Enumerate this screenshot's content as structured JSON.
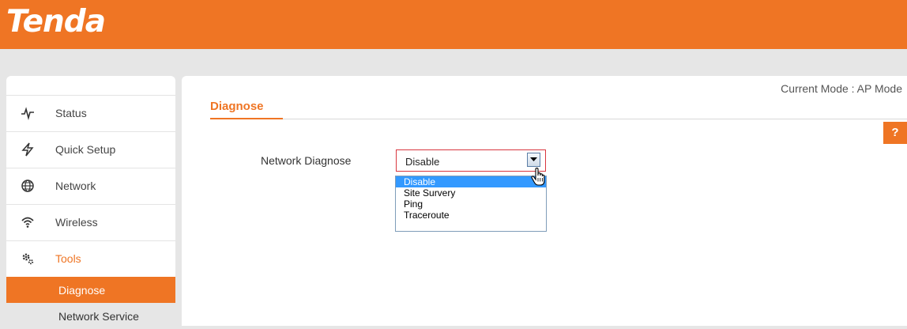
{
  "brand": {
    "logo_text": "Tenda",
    "accent": "#ef7524"
  },
  "sidebar": {
    "items": [
      {
        "label": "Status",
        "icon": "pulse-icon"
      },
      {
        "label": "Quick Setup",
        "icon": "bolt-icon"
      },
      {
        "label": "Network",
        "icon": "globe-icon"
      },
      {
        "label": "Wireless",
        "icon": "wifi-icon"
      },
      {
        "label": "Tools",
        "icon": "gears-icon"
      }
    ],
    "subitems": [
      {
        "label": "Diagnose"
      },
      {
        "label": "Network Service"
      }
    ]
  },
  "main": {
    "current_mode": "Current Mode : AP Mode",
    "section_title": "Diagnose",
    "help_label": "?",
    "field_label": "Network Diagnose",
    "select_value": "Disable",
    "options": [
      "Disable",
      "Site Survery",
      "Ping",
      "Traceroute"
    ]
  }
}
